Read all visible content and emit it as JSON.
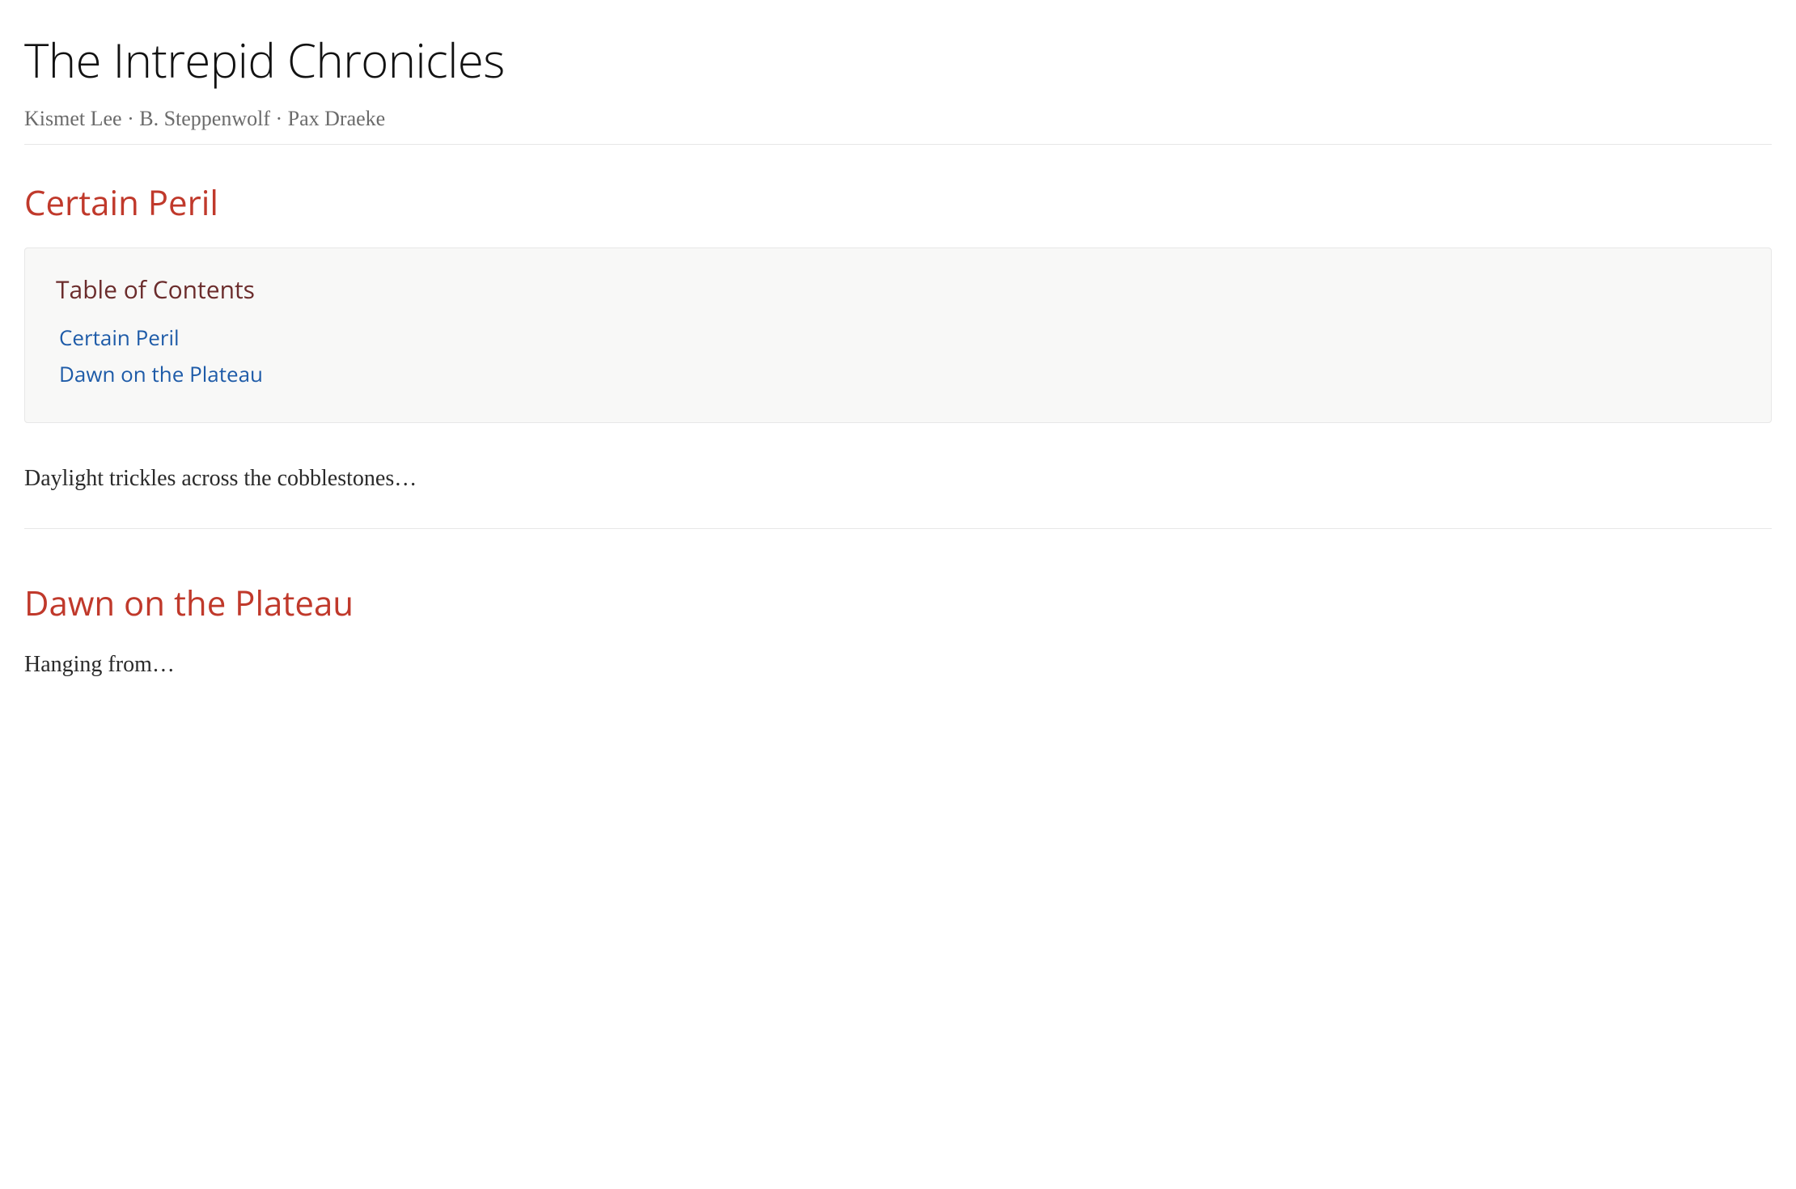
{
  "header": {
    "title": "The Intrepid Chronicles",
    "authors": "Kismet Lee · B. Steppenwolf · Pax Draeke"
  },
  "toc": {
    "title": "Table of Contents",
    "items": [
      {
        "label": "Certain Peril"
      },
      {
        "label": "Dawn on the Plateau"
      }
    ]
  },
  "sections": [
    {
      "heading": "Certain Peril",
      "body": "Daylight trickles across the cobblestones…"
    },
    {
      "heading": "Dawn on the Plateau",
      "body": "Hanging from…"
    }
  ]
}
